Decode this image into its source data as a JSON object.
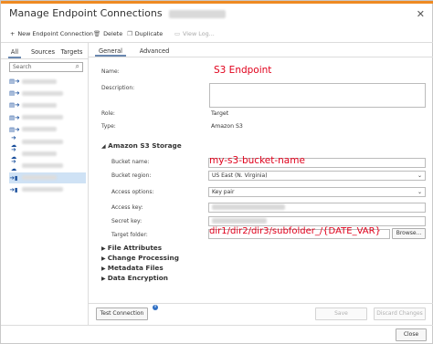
{
  "window": {
    "title": "Manage Endpoint Connections",
    "close_glyph": "✕"
  },
  "toolbar": {
    "new_label": "New Endpoint Connection",
    "delete_label": "Delete",
    "duplicate_label": "Duplicate",
    "viewlog_label": "View Log..."
  },
  "left_tabs": [
    "All",
    "Sources",
    "Targets"
  ],
  "search": {
    "placeholder": "Search"
  },
  "endpoints": [
    {
      "icon": "database-target-icon",
      "glyph": "▤➔"
    },
    {
      "icon": "database-target-icon",
      "glyph": "▤➔"
    },
    {
      "icon": "database-target-icon",
      "glyph": "▤➔"
    },
    {
      "icon": "database-target-icon",
      "glyph": "▤➔"
    },
    {
      "icon": "database-target-icon",
      "glyph": "▤➔"
    },
    {
      "icon": "cloud-source-icon",
      "glyph": "➔☁"
    },
    {
      "icon": "cloud-source-icon",
      "glyph": "➔☁"
    },
    {
      "icon": "cloud-source-icon",
      "glyph": "➔☁"
    },
    {
      "icon": "s3-bucket-icon",
      "glyph": "➔▮",
      "selected": true
    },
    {
      "icon": "s3-bucket-icon",
      "glyph": "➔▮"
    }
  ],
  "right_tabs": [
    "General",
    "Advanced"
  ],
  "general": {
    "name_label": "Name:",
    "name_value": "S3 Endpoint",
    "description_label": "Description:",
    "role_label": "Role:",
    "role_value": "Target",
    "type_label": "Type:",
    "type_value": "Amazon S3"
  },
  "s3_section": {
    "title": "Amazon S3 Storage",
    "bucket_name_label": "Bucket name:",
    "bucket_name_value": "my-s3-bucket-name",
    "bucket_region_label": "Bucket region:",
    "bucket_region_value": "US East (N. Virginia)",
    "access_options_label": "Access options:",
    "access_options_value": "Key pair",
    "access_key_label": "Access key:",
    "secret_key_label": "Secret key:",
    "target_folder_label": "Target folder:",
    "target_folder_value": "dir1/dir2/dir3/subfolder_/{DATE_VAR}",
    "browse_label": "Browse..."
  },
  "collapsed_sections": [
    "File Attributes",
    "Change Processing",
    "Metadata Files",
    "Data Encryption"
  ],
  "footer": {
    "test_label": "Test Connection",
    "info_glyph": "i",
    "save_label": "Save",
    "discard_label": "Discard Changes",
    "close_label": "Close"
  },
  "colors": {
    "accent": "#ee8a22",
    "annotation_red": "#e0001b",
    "selection": "#cfe2f5"
  }
}
